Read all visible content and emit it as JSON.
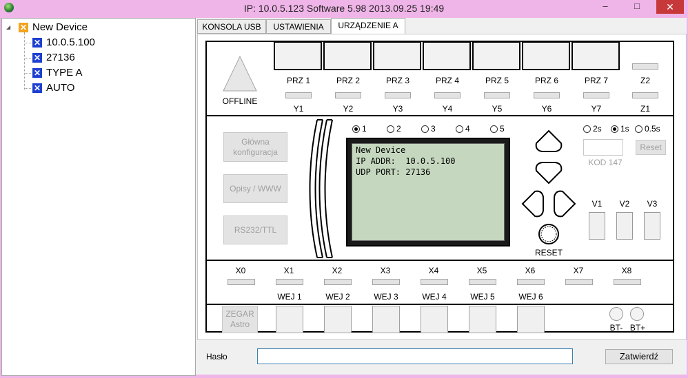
{
  "window": {
    "title": "IP: 10.0.5.123    Software 5.98  2013.09.25   19:49",
    "minimize": "–",
    "maximize": "□",
    "close": "✕"
  },
  "tree": {
    "root": "New Device",
    "children": [
      "10.0.5.100",
      "27136",
      "TYPE A",
      "AUTO"
    ],
    "expander": "◢"
  },
  "tabs": [
    "KONSOLA USB",
    "USTAWIENIA",
    "URZĄDZENIE A"
  ],
  "device": {
    "status": "OFFLINE",
    "relays": [
      "PRZ 1",
      "PRZ 2",
      "PRZ 3",
      "PRZ 4",
      "PRZ 5",
      "PRZ 6",
      "PRZ 7"
    ],
    "z2": "Z2",
    "z1": "Z1",
    "outputs": [
      "Y1",
      "Y2",
      "Y3",
      "Y4",
      "Y5",
      "Y6",
      "Y7"
    ],
    "buttons": {
      "main_config": "Główna konfiguracja",
      "desc": "Opisy / WWW",
      "rs232": "RS232/TTL",
      "clock": "ZEGAR Astro"
    },
    "screen_radios": [
      "1",
      "2",
      "3",
      "4",
      "5"
    ],
    "screen_selected": "1",
    "lcd_lines": [
      "New Device",
      "IP ADDR:  10.0.5.100",
      "UDP PORT: 27136"
    ],
    "time_radios": [
      "2s",
      "1s",
      "0.5s"
    ],
    "time_selected": "1s",
    "kod_label": "KOD 147",
    "reset_btn": "Reset",
    "reset_label": "RESET",
    "v": [
      "V1",
      "V2",
      "V3"
    ],
    "inputs_x": [
      "X0",
      "X1",
      "X2",
      "X3",
      "X4",
      "X5",
      "X6",
      "X7",
      "X8"
    ],
    "wej": [
      "WEJ 1",
      "WEJ 2",
      "WEJ 3",
      "WEJ 4",
      "WEJ 5",
      "WEJ 6"
    ],
    "bt_minus": "BT-",
    "bt_plus": "BT+"
  },
  "password": {
    "label": "Hasło",
    "value": "",
    "submit": "Zatwierdź"
  }
}
